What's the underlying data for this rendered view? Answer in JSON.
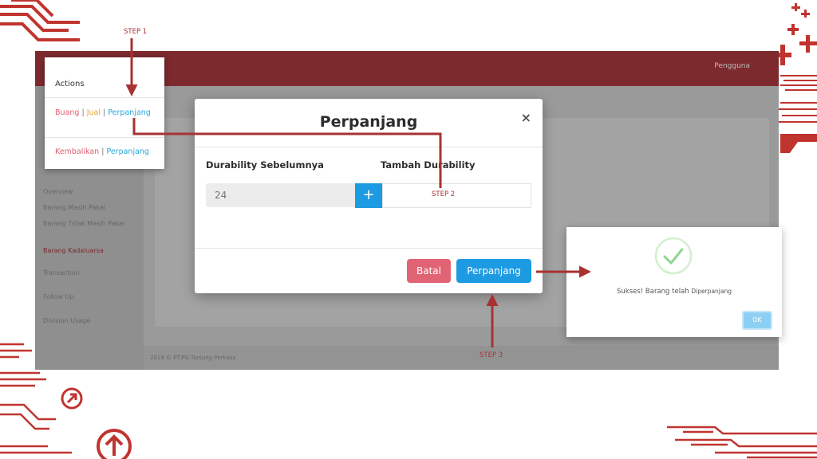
{
  "steps": {
    "step1": "STEP 1",
    "step2": "STEP 2",
    "step3": "STEP 3"
  },
  "actions_popup": {
    "title": "Actions",
    "row1": {
      "buang": "Buang",
      "sep1": "|",
      "jual": "Jual",
      "sep2": "|",
      "perpanjang": "Perpanjang"
    },
    "row2": {
      "kembalikan": "Kembalikan",
      "sep": "|",
      "perpanjang": "Perpanjang"
    }
  },
  "modal": {
    "title": "Perpanjang",
    "close": "×",
    "label_prev": "Durability Sebelumnya",
    "label_add": "Tambah Durability",
    "prev_value": "24",
    "plus": "+",
    "batal": "Batal",
    "perpanjang": "Perpanjang"
  },
  "alert": {
    "message_prefix": "Sukses! Barang telah",
    "message_suffix": "Diperpanjang",
    "ok": "OK"
  },
  "background_app": {
    "header_user": "Pengguna",
    "footer": "2019 © PT.PG Tanjung Perkasa"
  },
  "colors": {
    "accent_red": "#a83232",
    "primary_blue": "#1d9be2",
    "danger": "#e06474",
    "success": "#8fd48f"
  }
}
